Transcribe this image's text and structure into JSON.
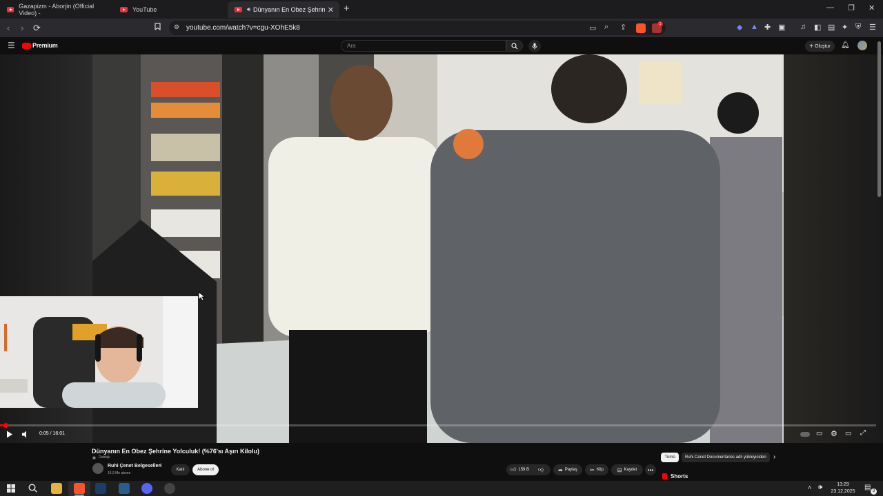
{
  "browser": {
    "tabs": [
      {
        "label": "Gazapizm - Aborjin (Official Video) -",
        "active": false
      },
      {
        "label": "YouTube",
        "active": false
      },
      {
        "label": "Dünyanın En Obez Şehrine Yo",
        "active": true
      }
    ],
    "url": "youtube.com/watch?v=cgu-XOhE5k8",
    "brave_badge": "1"
  },
  "youtube": {
    "logo_text": "Premium",
    "search_placeholder": "Ara",
    "create_label": "Oluştur",
    "player": {
      "time": "0:05 / 16:01",
      "progress_fraction": 0.0052
    },
    "video": {
      "title": "Dünyanın En Obez Şehrine Yolculuk! (%76'sı Aşırı Kilolu)",
      "dub_label": "Dublajlı",
      "channel_name": "Ruhi Çenet Belgeselleri",
      "subscribers": "16,9 Mn abone",
      "join_label": "Katıl",
      "subscribe_label": "Abone ol",
      "likes": "159 B",
      "share_label": "Paylaş",
      "clip_label": "Klip",
      "save_label": "Kaydet"
    },
    "chips": {
      "all_label": "Tümü",
      "channel_chip": "Ruhi Cenet Documentaries adlı yükleyiciden"
    },
    "shorts_label": "Shorts"
  },
  "taskbar": {
    "time": "13:29",
    "date": "23.12.2025",
    "notification_count": "3"
  },
  "colors": {
    "accent_red": "#ff0000",
    "background": "#0f0f0f",
    "chip_bg": "#272727"
  }
}
